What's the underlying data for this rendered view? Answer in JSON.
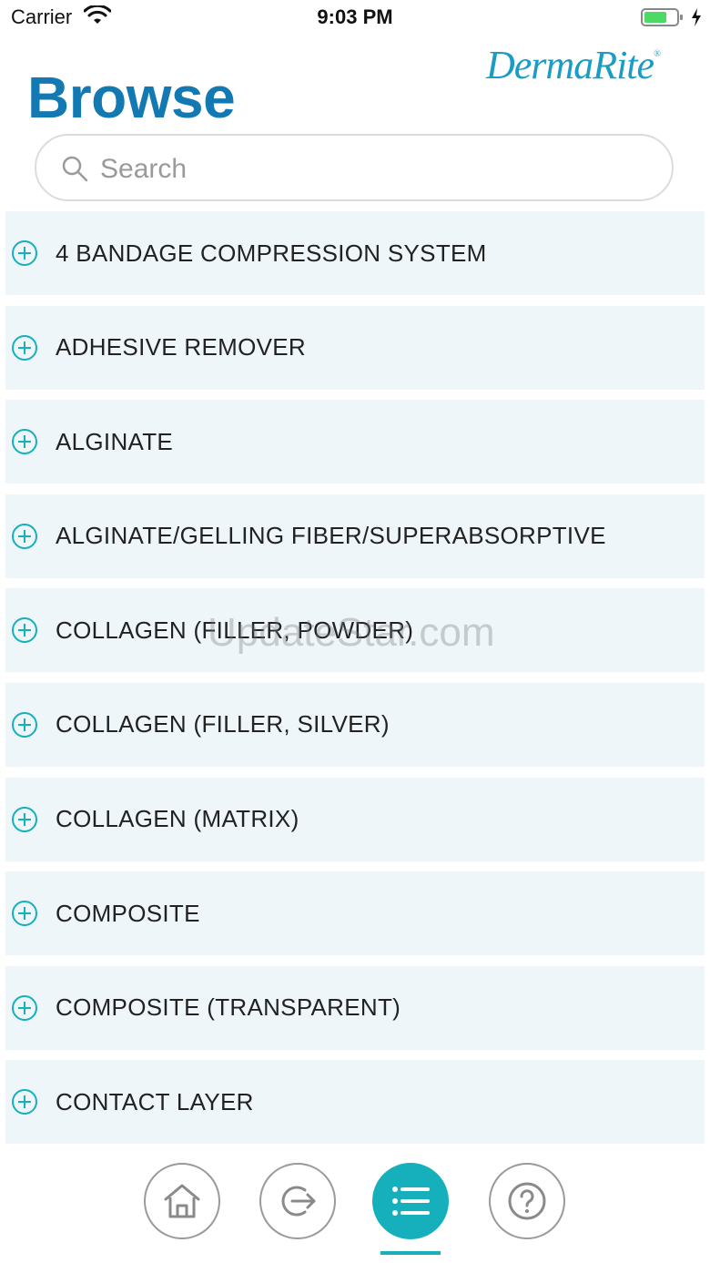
{
  "status_bar": {
    "carrier": "Carrier",
    "time": "9:03 PM"
  },
  "header": {
    "logo_text": "DermaRite",
    "logo_mark": "®",
    "title": "Browse"
  },
  "search": {
    "placeholder": "Search",
    "value": ""
  },
  "categories": [
    {
      "label": "4 BANDAGE COMPRESSION SYSTEM"
    },
    {
      "label": "ADHESIVE REMOVER"
    },
    {
      "label": "ALGINATE"
    },
    {
      "label": "ALGINATE/GELLING FIBER/SUPERABSORPTIVE"
    },
    {
      "label": "COLLAGEN (FILLER, POWDER)"
    },
    {
      "label": "COLLAGEN (FILLER, SILVER)"
    },
    {
      "label": "COLLAGEN (MATRIX)"
    },
    {
      "label": "COMPOSITE"
    },
    {
      "label": "COMPOSITE (TRANSPARENT)"
    },
    {
      "label": "CONTACT LAYER"
    }
  ],
  "watermark": "UpdateStar.com",
  "tab_bar": {
    "tabs": [
      {
        "icon": "home-icon",
        "active": false
      },
      {
        "icon": "logout-icon",
        "active": false
      },
      {
        "icon": "list-icon",
        "active": true
      },
      {
        "icon": "help-icon",
        "active": false
      }
    ]
  },
  "colors": {
    "accent": "#16b0bd",
    "title": "#1379b3",
    "logo": "#1b9cc6",
    "list_bg": "#eef6f9",
    "battery": "#4cd964"
  }
}
